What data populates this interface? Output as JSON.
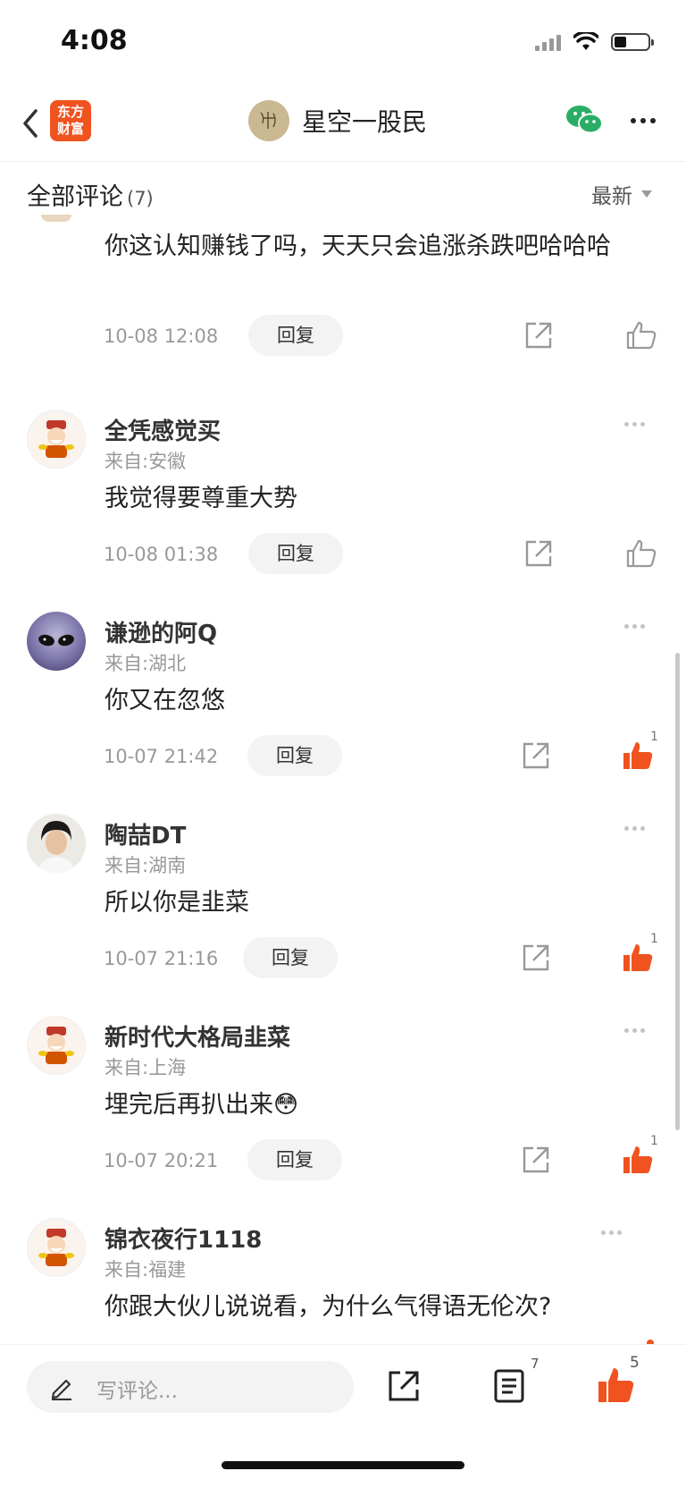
{
  "status_bar": {
    "time": "4:08"
  },
  "nav": {
    "logo_text_1": "东方",
    "logo_text_2": "财富",
    "title": "星空一股民"
  },
  "comments_header": {
    "title": "全部评论",
    "count": "(7)",
    "sort": "最新"
  },
  "comments": [
    {
      "username": "",
      "location": "",
      "content": "你这认知赚钱了吗，天天只会追涨杀跌吧哈哈哈",
      "time": "10-08 12:08",
      "reply": "回复",
      "likes": "",
      "liked": false
    },
    {
      "username": "全凭感觉买",
      "location": "来自:安徽",
      "content": "我觉得要尊重大势",
      "time": "10-08 01:38",
      "reply": "回复",
      "likes": "",
      "liked": false
    },
    {
      "username": "谦逊的阿Q",
      "location": "来自:湖北",
      "content": "你又在忽悠",
      "time": "10-07 21:42",
      "reply": "回复",
      "likes": "1",
      "liked": true
    },
    {
      "username": "陶喆DT",
      "location": "来自:湖南",
      "content": "所以你是韭菜",
      "time": "10-07 21:16",
      "reply": "回复",
      "likes": "1",
      "liked": true
    },
    {
      "username": "新时代大格局韭菜",
      "location": "来自:上海",
      "content": "埋完后再扒出来",
      "emoji": "😳",
      "time": "10-07 20:21",
      "reply": "回复",
      "likes": "1",
      "liked": true
    },
    {
      "username": "锦衣夜行1118",
      "location": "来自:福建",
      "content": "你跟大伙儿说说看，为什么气得语无伦次?",
      "time": "",
      "reply": "",
      "likes": "",
      "liked": false
    }
  ],
  "bottom_bar": {
    "placeholder": "写评论...",
    "comment_count": "7",
    "like_count": "5"
  },
  "colors": {
    "accent": "#f0531f",
    "wechat": "#2aae67"
  }
}
